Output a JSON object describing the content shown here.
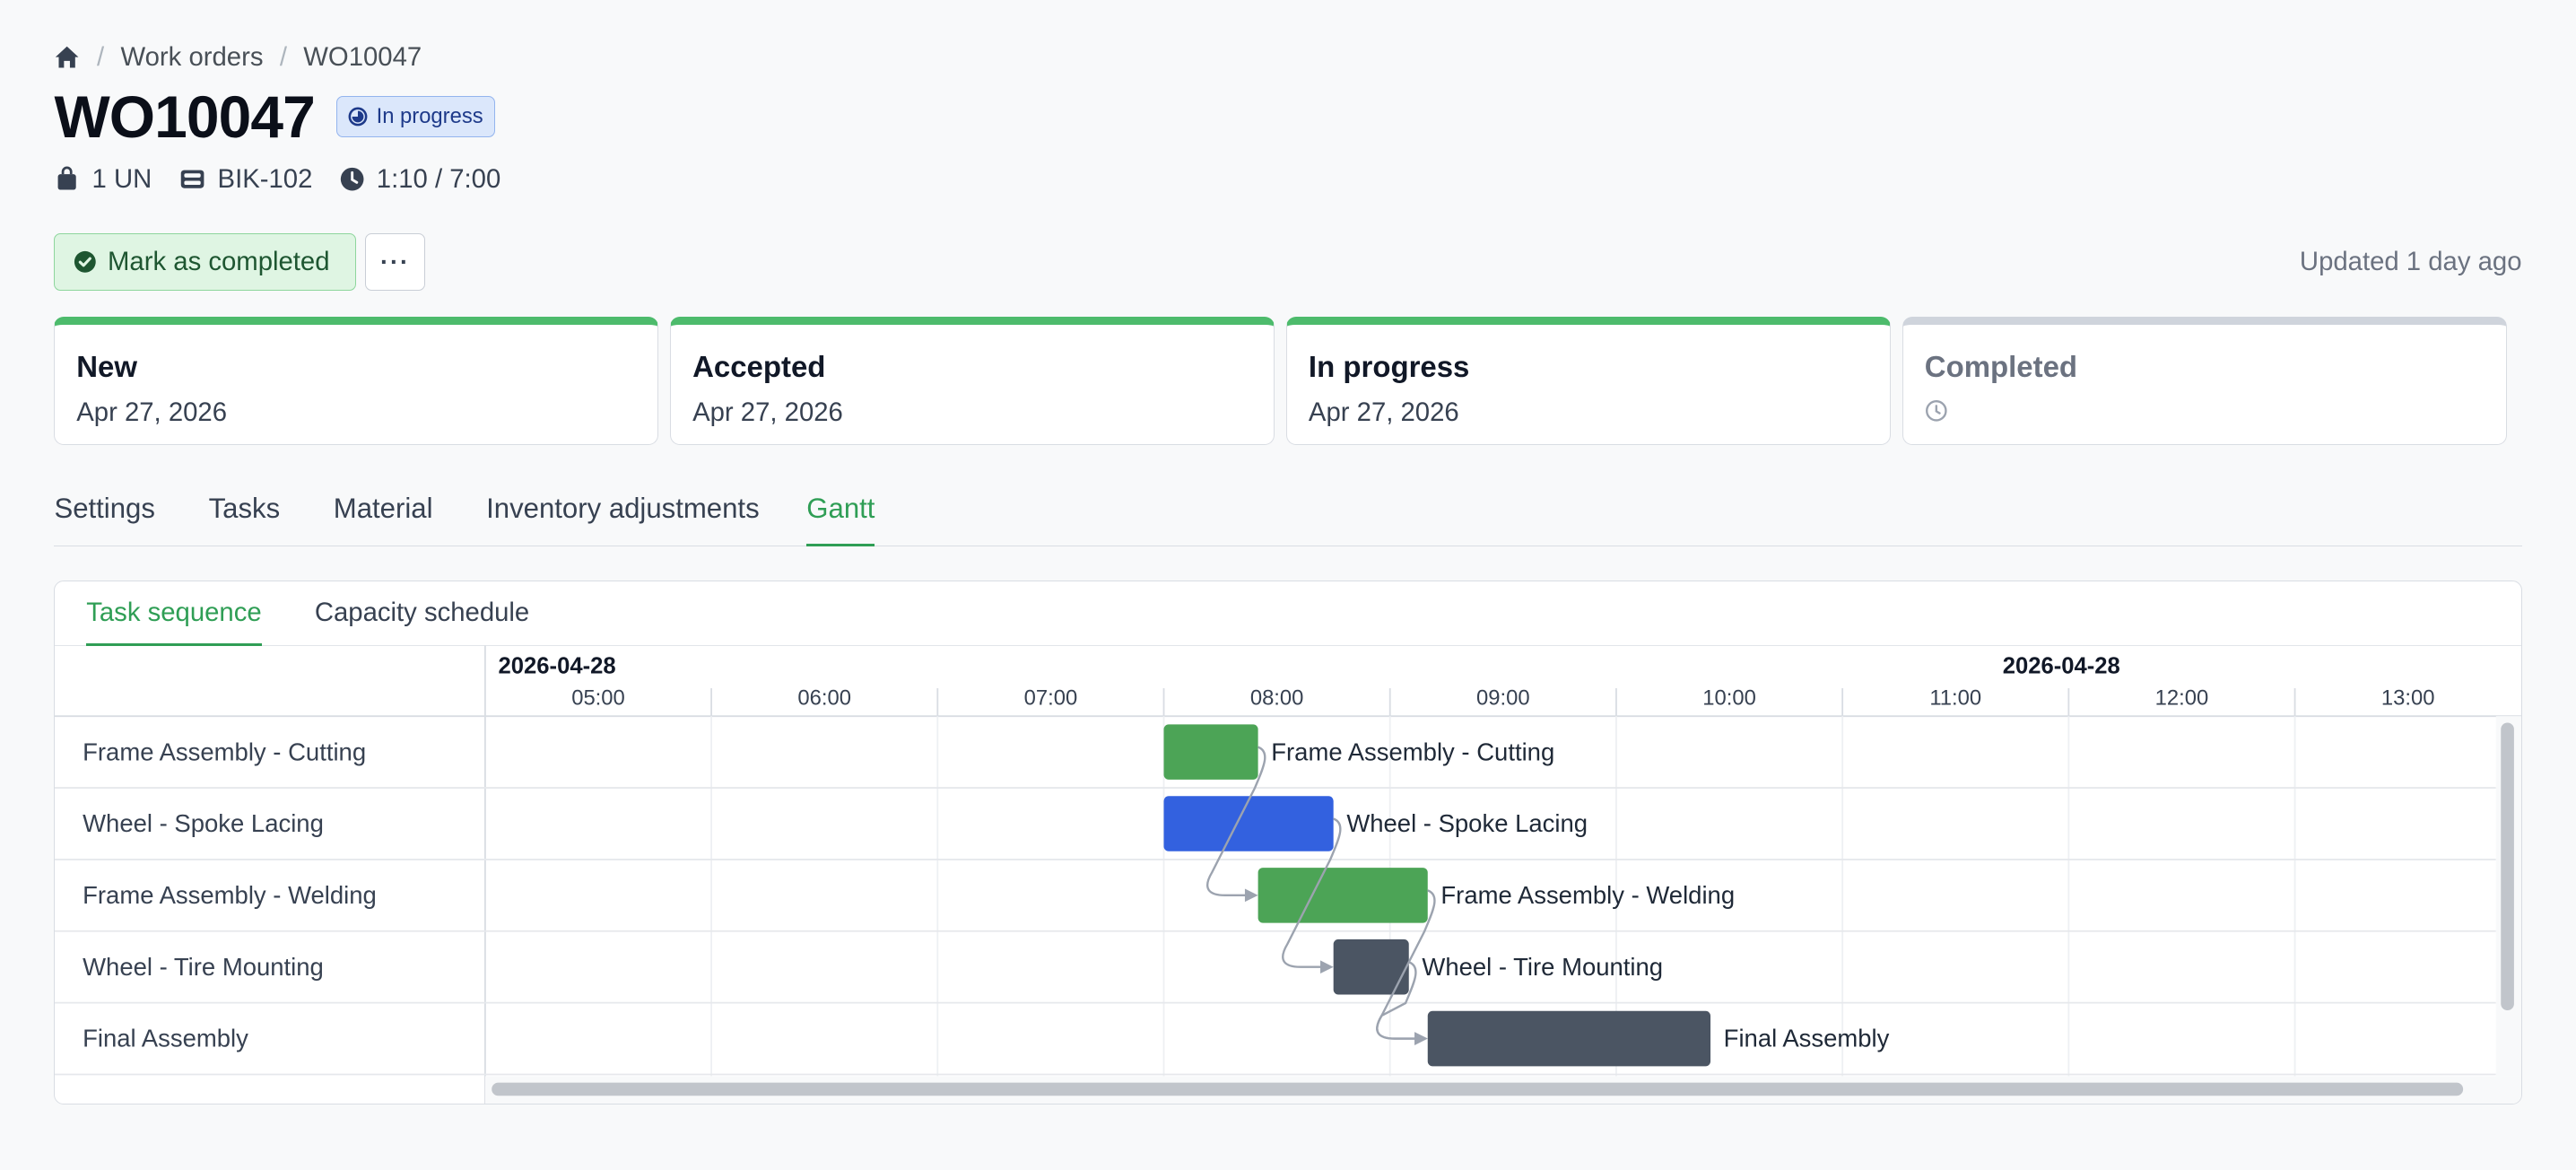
{
  "breadcrumb": {
    "home_icon": "home-icon",
    "items": [
      "Work orders",
      "WO10047"
    ]
  },
  "header": {
    "title": "WO10047",
    "status_badge": "In progress",
    "status_icon": "progress-circle-icon",
    "meta": {
      "quantity": "1 UN",
      "product": "BIK-102",
      "time": "1:10 / 7:00"
    }
  },
  "actions": {
    "mark_completed_label": "Mark as completed",
    "more_label": "···",
    "updated_text": "Updated 1 day ago"
  },
  "status_steps": [
    {
      "name": "New",
      "date": "Apr 27, 2026",
      "done": true
    },
    {
      "name": "Accepted",
      "date": "Apr 27, 2026",
      "done": true
    },
    {
      "name": "In progress",
      "date": "Apr 27, 2026",
      "done": true
    },
    {
      "name": "Completed",
      "date": "",
      "done": false
    }
  ],
  "tabs": [
    "Settings",
    "Tasks",
    "Material",
    "Inventory adjustments",
    "Gantt"
  ],
  "active_tab": "Gantt",
  "gantt": {
    "subtabs": [
      "Task sequence",
      "Capacity schedule"
    ],
    "active_subtab": "Task sequence",
    "date_labels": [
      "2026-04-28",
      "2026-04-28"
    ],
    "hours": [
      "05:00",
      "06:00",
      "07:00",
      "08:00",
      "09:00",
      "10:00",
      "11:00",
      "12:00",
      "13:00"
    ],
    "tasks": [
      {
        "name": "Frame Assembly - Cutting",
        "start": "07:30",
        "end": "07:55",
        "color": "#4ca456"
      },
      {
        "name": "Wheel - Spoke Lacing",
        "start": "07:30",
        "end": "08:15",
        "color": "#3361df"
      },
      {
        "name": "Frame Assembly - Welding",
        "start": "07:55",
        "end": "08:40",
        "color": "#4ca456"
      },
      {
        "name": "Wheel - Tire Mounting",
        "start": "08:15",
        "end": "08:35",
        "color": "#4b5563"
      },
      {
        "name": "Final Assembly",
        "start": "08:40",
        "end": "09:55",
        "color": "#4b5563"
      }
    ]
  },
  "colors": {
    "accent_green": "#2f9e55",
    "badge_blue": "#dbe7fb",
    "complete_green_bg": "#dff5e3"
  }
}
